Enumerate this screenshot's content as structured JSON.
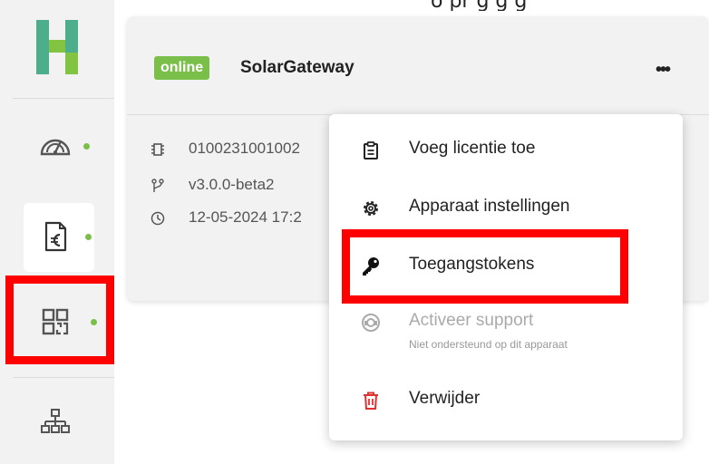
{
  "top_strip": {
    "text": "o pr      g g g"
  },
  "sidebar": {
    "logo": "H-logo",
    "items": [
      {
        "icon": "dashboard-gauge-icon",
        "status": "online"
      },
      {
        "icon": "invoice-euro-icon",
        "status": "online",
        "active": true
      },
      {
        "icon": "qr-code-icon",
        "status": "online",
        "highlighted": true
      },
      {
        "icon": "network-hierarchy-icon"
      }
    ]
  },
  "card": {
    "status_badge": "online",
    "device_name": "SolarGateway",
    "more_label": "•••",
    "serial": "0100231001002",
    "version": "v3.0.0-beta2",
    "timestamp": "12-05-2024 17:2"
  },
  "menu": {
    "items": [
      {
        "label": "Voeg licentie toe",
        "icon": "clipboard-icon"
      },
      {
        "label": "Apparaat instellingen",
        "icon": "gear-icon"
      },
      {
        "label": "Toegangstokens",
        "icon": "key-icon",
        "highlighted": true
      },
      {
        "label": "Activeer support",
        "icon": "headset-icon",
        "disabled": true,
        "sub": "Niet ondersteund op dit apparaat"
      },
      {
        "label": "Verwijder",
        "icon": "trash-icon",
        "danger": true
      }
    ]
  },
  "colors": {
    "online": "#7bbf4b",
    "highlight": "#ff0000",
    "danger": "#e03131",
    "logo": "#6fbf5a"
  }
}
